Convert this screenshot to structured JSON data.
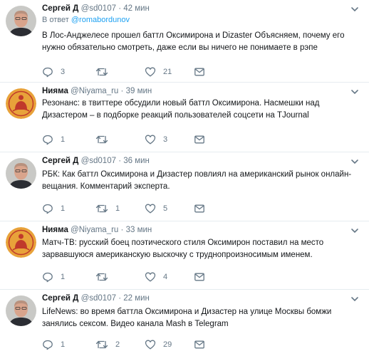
{
  "tweets": [
    {
      "name": "Сергей Д",
      "handle": "@sd0107",
      "separator": "·",
      "time": "42 мин",
      "reply_prefix": "В ответ",
      "reply_to": "@romabordunov",
      "text": "В Лос-Анджелесе прошел баттл Оксимирона и Dizaster Объясняем, почему его нужно обязательно смотреть, даже если вы ничего не понимаете в рэпе",
      "replies": "3",
      "retweets": "",
      "likes": "21"
    },
    {
      "name": "Нияма",
      "handle": "@Niyama_ru",
      "separator": "·",
      "time": "39 мин",
      "text": "Резонанс: в твиттере обсудили новый баттл Оксимирона. Насмешки над Дизастером – в подборке реакций пользователей соцсети на TJournal",
      "replies": "1",
      "retweets": "",
      "likes": "3"
    },
    {
      "name": "Сергей Д",
      "handle": "@sd0107",
      "separator": "·",
      "time": "36 мин",
      "text": "РБК: Как баттл Оксимирона и Дизастер повлиял на американский рынок онлайн-вещания. Комментарий эксперта.",
      "replies": "1",
      "retweets": "1",
      "likes": "5"
    },
    {
      "name": "Нияма",
      "handle": "@Niyama_ru",
      "separator": "·",
      "time": "33 мин",
      "text": "Матч-ТВ: русский боец поэтического стиля Оксимирон поставил на место зарвавшуюся американскую выскочку с труднопроизносимым именем.",
      "replies": "1",
      "retweets": "",
      "likes": "4"
    },
    {
      "name": "Сергей Д",
      "handle": "@sd0107",
      "separator": "·",
      "time": "22 мин",
      "text": "LifeNews: во время баттла Оксимирона и Дизастер на улице Москвы бомжи занялись сексом. Видео канала Mash в Telegram",
      "replies": "1",
      "retweets": "2",
      "likes": "29"
    }
  ],
  "colors": {
    "icon": "#657786",
    "link": "#1da1f2",
    "text": "#14171a",
    "divider": "#e6ecf0",
    "niyama_logo_bg": "#e8a23a",
    "niyama_logo_fg": "#c0392b"
  },
  "icons": [
    "reply-icon",
    "retweet-icon",
    "like-icon",
    "dm-icon",
    "chevron-down-icon"
  ]
}
